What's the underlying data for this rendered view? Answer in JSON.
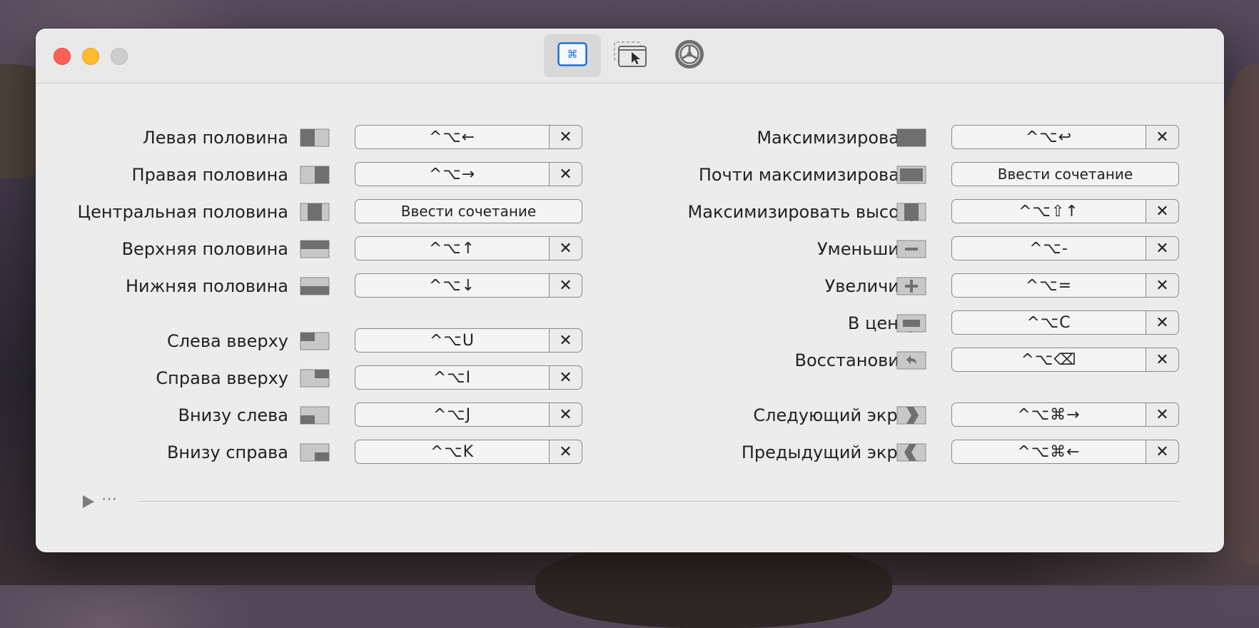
{
  "window": {
    "toolbar": {
      "tabs": [
        {
          "icon": "command-key-icon",
          "active": true
        },
        {
          "icon": "window-cursor-icon",
          "active": false
        },
        {
          "icon": "gear-icon",
          "active": false
        }
      ]
    }
  },
  "left": [
    {
      "label": "Левая половина",
      "icon": "left-half-icon",
      "shortcut": "^⌥←",
      "clearable": true
    },
    {
      "label": "Правая половина",
      "icon": "right-half-icon",
      "shortcut": "^⌥→",
      "clearable": true
    },
    {
      "label": "Центральная половина",
      "icon": "center-half-icon",
      "shortcut": "Ввести сочетание",
      "clearable": false
    },
    {
      "label": "Верхняя половина",
      "icon": "top-half-icon",
      "shortcut": "^⌥↑",
      "clearable": true
    },
    {
      "label": "Нижняя половина",
      "icon": "bottom-half-icon",
      "shortcut": "^⌥↓",
      "clearable": true
    },
    {
      "label": "Слева вверху",
      "icon": "top-left-icon",
      "shortcut": "^⌥U",
      "clearable": true
    },
    {
      "label": "Справа вверху",
      "icon": "top-right-icon",
      "shortcut": "^⌥I",
      "clearable": true
    },
    {
      "label": "Внизу слева",
      "icon": "bottom-left-icon",
      "shortcut": "^⌥J",
      "clearable": true
    },
    {
      "label": "Внизу справа",
      "icon": "bottom-right-icon",
      "shortcut": "^⌥K",
      "clearable": true
    }
  ],
  "right": [
    {
      "label": "Максимизировать",
      "icon": "maximize-icon",
      "shortcut": "^⌥↩",
      "clearable": true
    },
    {
      "label": "Почти максимизировать",
      "icon": "almost-maximize-icon",
      "shortcut": "Ввести сочетание",
      "clearable": false
    },
    {
      "label": "Максимизировать высоту",
      "icon": "maximize-height-icon",
      "shortcut": "^⌥⇧↑",
      "clearable": true
    },
    {
      "label": "Уменьшить",
      "icon": "minus-icon",
      "shortcut": "^⌥-",
      "clearable": true
    },
    {
      "label": "Увеличить",
      "icon": "plus-icon",
      "shortcut": "^⌥=",
      "clearable": true
    },
    {
      "label": "В центр",
      "icon": "center-icon",
      "shortcut": "^⌥C",
      "clearable": true
    },
    {
      "label": "Восстановить",
      "icon": "restore-icon",
      "shortcut": "^⌥⌫",
      "clearable": true
    },
    {
      "label": "Следующий экран",
      "icon": "next-display-icon",
      "shortcut": "^⌥⌘→",
      "clearable": true
    },
    {
      "label": "Предыдущий экран",
      "icon": "previous-display-icon",
      "shortcut": "^⌥⌘←",
      "clearable": true
    }
  ],
  "clear_symbol": "✕",
  "footer": {
    "toggle_icon": "disclosure-triangle-icon",
    "dots": "⋯"
  },
  "colors": {
    "accent": "#1f6fd6",
    "icon_dark": "#6f6f6f",
    "icon_light": "#c8c8c8"
  }
}
